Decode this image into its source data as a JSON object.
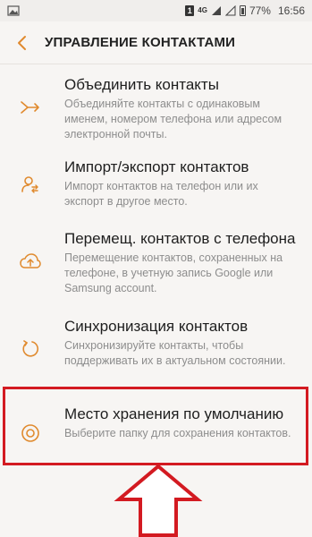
{
  "status_bar": {
    "sim": "1",
    "network": "4G",
    "battery_percent": "77%",
    "time": "16:56"
  },
  "header": {
    "title": "УПРАВЛЕНИЕ КОНТАКТАМИ"
  },
  "accent_color": "#e08a2e",
  "highlight_color": "#d31a21",
  "items": [
    {
      "icon": "merge-icon",
      "title": "Объединить контакты",
      "desc": "Объединяйте контакты с одинаковым именем, номером телефона или адресом электронной почты."
    },
    {
      "icon": "import-export-icon",
      "title": "Импорт/экспорт контактов",
      "desc": "Импорт контактов на телефон или их экспорт в другое место."
    },
    {
      "icon": "cloud-upload-icon",
      "title": "Перемещ. контактов с телефона",
      "desc": "Перемещение контактов, сохраненных на телефоне, в учетную запись Google или Samsung account."
    },
    {
      "icon": "sync-icon",
      "title": "Синхронизация контактов",
      "desc": "Синхронизируйте контакты, чтобы поддерживать их в актуальном состоянии."
    },
    {
      "icon": "storage-icon",
      "title": "Место хранения по умолчанию",
      "desc": "Выберите папку для сохранения контактов."
    }
  ]
}
